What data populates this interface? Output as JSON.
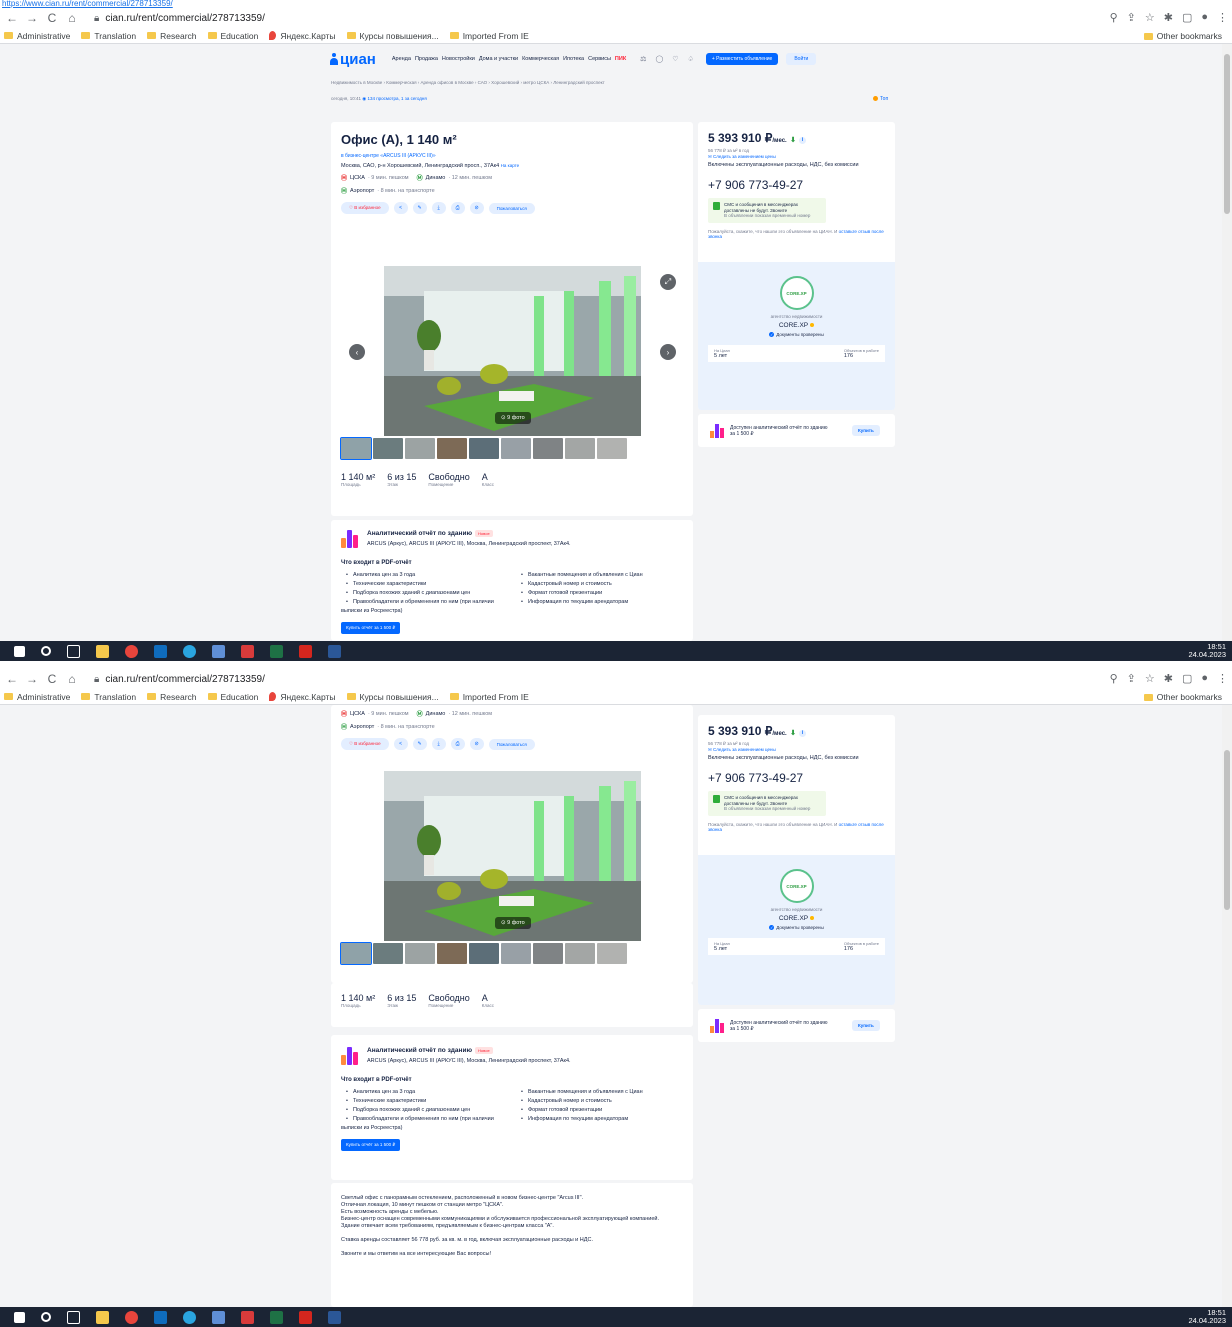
{
  "top_url": "https://www.cian.ru/rent/commercial/278713359/",
  "browser": {
    "url_host": "cian.ru/rent/commercial/278713359/",
    "bookmarks": [
      "Administrative",
      "Translation",
      "Research",
      "Education",
      "Яндекс.Карты",
      "Курсы повышения...",
      "Imported From IE"
    ],
    "other_bookmarks": "Other bookmarks"
  },
  "header": {
    "logo": "циан",
    "menu": [
      "Аренда",
      "Продажа",
      "Новостройки",
      "Дома и участки",
      "Коммерческая",
      "Ипотека",
      "Сервисы"
    ],
    "menu_promo": "ПИК",
    "post_button": "+ Разместить объявление",
    "login_button": "Войти"
  },
  "breadcrumbs": "Недвижимость в Москве › Коммерческая › Аренда офисов в Москве › САО › Хорошевский › метро ЦСКА › Ленинградский проспект",
  "meta": {
    "date": "сегодня, 10:41",
    "views": "134 просмотра, 1 за сегодня",
    "top": "Топ"
  },
  "listing": {
    "title": "Офис (A), 1 140 м²",
    "business_center": "в бизнес-центре «ARCUS III (АРКУС III)»",
    "address": "Москва, САО, р-н Хорошевский, Ленинградский просп., 37Ак4",
    "on_map": "На карте",
    "metro1": "ЦСКА",
    "metro1_walk": "· 9 мин. пешком",
    "metro2": "Динамо",
    "metro2_walk": "· 12 мин. пешком",
    "metro3": "Аэропорт",
    "metro3_walk": "· 8 мин. на транспорте",
    "fav": "♡ В избранное",
    "complain": "Пожаловаться",
    "photos_badge": "⊙ 9 фото",
    "facts": [
      {
        "value": "1 140 м²",
        "label": "Площадь"
      },
      {
        "value": "6 из 15",
        "label": "Этаж"
      },
      {
        "value": "Свободно",
        "label": "Помещение"
      },
      {
        "value": "A",
        "label": "Класс"
      }
    ]
  },
  "report": {
    "title": "Аналитический отчёт по зданию",
    "badge": "Новое",
    "subtitle": "ARCUS (Аркус), ARCUS III (АРКУС III), Москва, Ленинградский проспект, 37Ак4.",
    "includes_title": "Что входит в PDF-отчёт",
    "items": [
      "Аналитика цен за 3 года",
      "Вакантные помещения и объявления с Циан",
      "Технические характеристики",
      "Кадастровый номер и стоимость",
      "Подборка похожих зданий с диапазонами цен",
      "Формат готовой презентации",
      "Правообладатели и обременения по ним (при наличии выписки из Росреестра)",
      "Информация по текущим арендаторам"
    ],
    "buy": "Купить отчёт за 1 500 ₽"
  },
  "side": {
    "price": "5 393 910 ₽",
    "per": "/мес.",
    "price_m2": "56 778 ₽ за м² в год",
    "follow": "Следить за изменением цены",
    "included": "Включены эксплуатационные расходы, НДС, без комиссии",
    "phone": "+7 906 773-49-27",
    "sms1": "СМС и сообщения в мессенджерах доставлены не будут. Звоните",
    "sms2": "В объявлении показан временный номер",
    "please": "Пожалуйста, скажите, что нашли это объявление на ЦИАН. И",
    "review": "оставьте отзыв после звонка",
    "agency_logo": "CORE.XP",
    "agency_type": "агентство недвижимости",
    "agency_name": "CORE.XP",
    "verified": "Документы проверены",
    "on_cian_label": "На Циан",
    "on_cian_value": "5 лет",
    "objects_label": "Объектов в работе",
    "objects_value": "176",
    "analytic": "Доступен аналитический отчёт по зданию за 1 500 ₽",
    "analytic_buy": "Купить"
  },
  "description": [
    "Светлый офис с панорамным остеклением, расположенный в новом бизнес-центре \"Arcus III\".",
    "Отличная локация, 10 минут пешком от станции метро \"ЦСКА\".",
    "Есть возможность аренды с мебелью.",
    "Бизнес-центр оснащен современными коммуникациями и обслуживается профессиональной эксплуатирующей компанией.",
    "Здание отвечает всем требованиям, предъявляемым к бизнес-центрам класса \"А\".",
    "Ставка аренды составляет 56 778 руб. за кв. м. в год, включая эксплуатационные расходы и НДС.",
    "Звоните и мы ответим на все интересующие Вас вопросы!"
  ],
  "clock": {
    "time": "18:51",
    "date": "24.04.2023"
  }
}
